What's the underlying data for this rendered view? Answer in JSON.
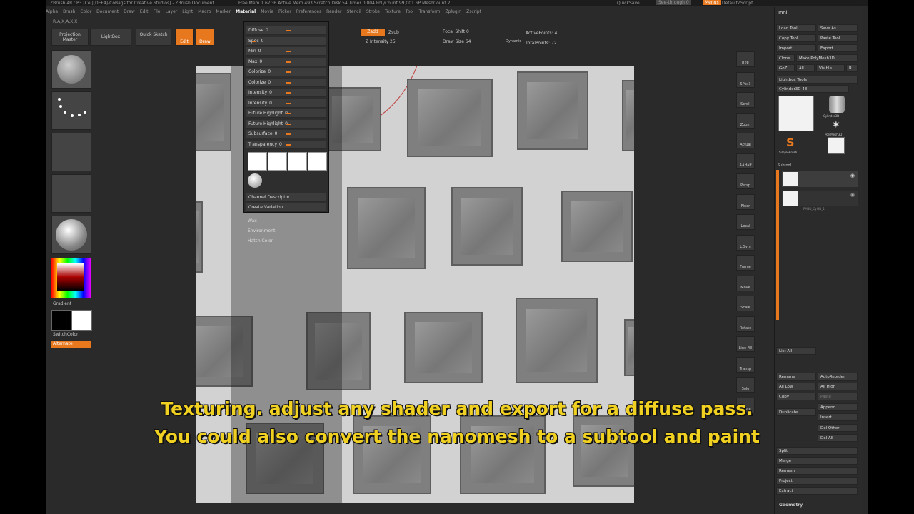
{
  "titlebar": {
    "title": "ZBrush 4R7 P3 [Cei][DEF4]-CoBags for Creative Studios] - ZBrush Document",
    "stats": "Free Mem 1.67GB  Active Mem 493  Scratch Disk 54  Timer 0.004  PolyCount 99,001 SP  MeshCount 2",
    "quicksave": "QuickSave",
    "seethrough": "See-through 0",
    "menus_label": "Menus",
    "script": "DefaultZScript"
  },
  "menubar": [
    "Alpha",
    "Brush",
    "Color",
    "Document",
    "Draw",
    "Edit",
    "File",
    "Layer",
    "Light",
    "Macro",
    "Marker",
    "Material",
    "Movie",
    "Picker",
    "Preferences",
    "Render",
    "Stencil",
    "Stroke",
    "Texture",
    "Tool",
    "Transform",
    "Zplugin",
    "Zscript"
  ],
  "toolbar": {
    "mode": "R,A,X,A,X,X",
    "projection_master": "Projection Master",
    "lightbox": "LightBox",
    "quick_sketch": "Quick Sketch",
    "edit": "Edit",
    "draw": "Draw",
    "zadd": "Zadd",
    "zsub": "Zsub",
    "z_intensity": "Z Intensity 25",
    "focal_shift": "Focal Shift 0",
    "draw_size": "Draw Size 64",
    "dynamic": "Dynamic",
    "active_points": "ActivePoints: 4",
    "total_points": "TotalPoints: 72"
  },
  "material_panel": {
    "sliders": [
      {
        "label": "Diffuse",
        "value": "0"
      },
      {
        "label": "Spec",
        "value": "0"
      },
      {
        "label": "Min",
        "value": "0"
      },
      {
        "label": "Max",
        "value": "0"
      },
      {
        "label": "Colorize",
        "value": "0"
      },
      {
        "label": "Colorize",
        "value": "0"
      },
      {
        "label": "Intensity",
        "value": "0"
      },
      {
        "label": "Intensity",
        "value": "0"
      },
      {
        "label": "Future Highlight",
        "value": "0"
      },
      {
        "label": "Future Highlight",
        "value": "0"
      },
      {
        "label": "Subsurface",
        "value": "0"
      },
      {
        "label": "Transparency",
        "value": "0"
      }
    ],
    "channel_descriptor": "Channel Descriptor",
    "create_variation": "Create Variation",
    "extra_items": [
      "Wax",
      "Environment",
      "Hatch Color"
    ]
  },
  "left_shelf": {
    "gradient": "Gradient",
    "switch_color": "SwitchColor",
    "alternate": "Alternate"
  },
  "right_shelf": [
    "BPR",
    "SPix 3",
    "Scroll",
    "Zoom",
    "Actual",
    "AAHalf",
    "Persp",
    "Floor",
    "Local",
    "L.Sym",
    "Frame",
    "Move",
    "Scale",
    "Rotate",
    "Line Fill",
    "Transp",
    "Solo",
    "Xpose"
  ],
  "tool_panel": {
    "title": "Tool",
    "load_tool": "Load Tool",
    "save_as": "Save As",
    "copy_tool": "Copy Tool",
    "paste_tool": "Paste Tool",
    "import": "Import",
    "export": "Export",
    "clone": "Clone",
    "make_polymesh": "Make PolyMesh3D",
    "goz": "GoZ",
    "all": "All",
    "visible": "Visible",
    "r": "R",
    "lightbox_tools": "Lightbox Tools",
    "cylinder": "Cylinder3D 48",
    "tool_name_1": "Cylinder3D",
    "tool_name_2": "PolyMesh3D",
    "tool_name_3": "SimpleBrush",
    "subtool": "Subtool",
    "subtool_item": "PM3D_Cyl3D_1",
    "list_all": "List All",
    "rename": "Rename",
    "autoreorder": "AutoReorder",
    "all_low": "All Low",
    "all_high": "All High",
    "copy": "Copy",
    "paste": "Paste",
    "duplicate": "Duplicate",
    "append": "Append",
    "insert": "Insert",
    "del_other": "Del Other",
    "del_all": "Del All",
    "split": "Split",
    "merge": "Merge",
    "remesh": "Remesh",
    "project": "Project",
    "extract": "Extract",
    "geometry": "Geometry"
  },
  "caption": {
    "line1": "Texturing.  adjust any shader and export for a diffuse pass.",
    "line2": "You could also convert the nanomesh to a subtool and paint"
  },
  "colors": {
    "accent": "#e8781e",
    "caption": "#f0d020"
  }
}
